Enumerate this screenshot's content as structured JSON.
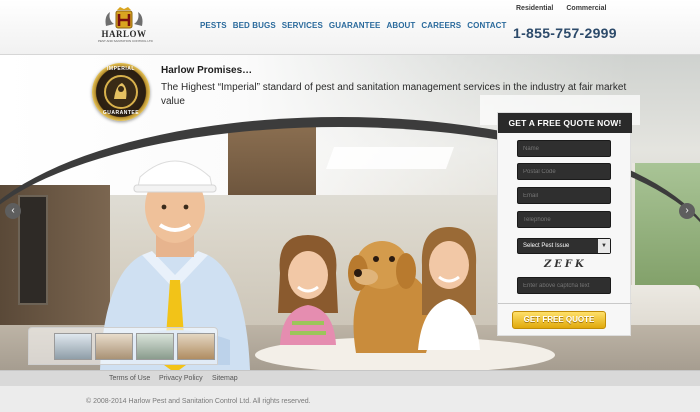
{
  "header": {
    "logo_word": "HARLOW",
    "logo_tagline": "PEST AND SANITATION CONTROL LTD",
    "nav": [
      "PESTS",
      "BED BUGS",
      "SERVICES",
      "GUARANTEE",
      "ABOUT",
      "CAREERS",
      "CONTACT"
    ],
    "toplinks": [
      "Residential",
      "Commercial"
    ],
    "phone": "1-855-757-2999"
  },
  "hero": {
    "badge_top": "IMPERIAL",
    "badge_bottom": "GUARANTEE",
    "promise_title": "Harlow Promises…",
    "promise_text": "The Highest “Imperial” standard of pest and sanitation management services in the industry at fair market value",
    "prev_icon": "chevron-left-icon",
    "next_icon": "chevron-right-icon"
  },
  "quote_form": {
    "heading": "GET A FREE QUOTE NOW!",
    "name_placeholder": "Name",
    "postal_placeholder": "Postal Code",
    "email_placeholder": "Email",
    "phone_placeholder": "Telephone",
    "select_value": "Select Pest Issue",
    "captcha_text": "ZEFK",
    "captcha_placeholder": "Enter above captcha text",
    "submit_label": "GET FREE QUOTE"
  },
  "footer": {
    "links": [
      "Terms of Use",
      "Privacy Policy",
      "Sitemap"
    ],
    "copyright": "© 2008-2014 Harlow Pest and Sanitation Control Ltd. All rights reserved."
  },
  "colors": {
    "nav": "#2a6a9c",
    "phone": "#2c4a6a",
    "quote_head": "#2a2a2a",
    "submit": "#e0a90c"
  }
}
